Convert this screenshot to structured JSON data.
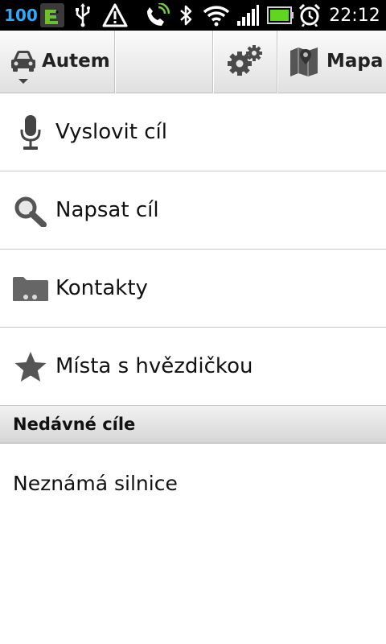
{
  "status_bar": {
    "battery_level": "100",
    "time": "22:12",
    "icons": [
      "app-icon",
      "usb-icon",
      "warning-icon",
      "phone-icon",
      "bluetooth-icon",
      "wifi-icon",
      "signal-icon",
      "battery-icon",
      "alarm-icon"
    ]
  },
  "action_bar": {
    "mode_label": "Autem",
    "map_label": "Mapa",
    "icons": [
      "car-icon",
      "gears-icon",
      "map-icon"
    ]
  },
  "menu": {
    "items": [
      {
        "label": "Vyslovit cíl",
        "icon": "microphone-icon"
      },
      {
        "label": "Napsat cíl",
        "icon": "search-icon"
      },
      {
        "label": "Kontakty",
        "icon": "contacts-folder-icon"
      },
      {
        "label": "Místa s hvězdičkou",
        "icon": "star-icon"
      }
    ]
  },
  "recent": {
    "header": "Nedávné cíle",
    "items": [
      "Neznámá silnice"
    ]
  },
  "colors": {
    "battery_text": "#2fa8ff",
    "app_icon_green": "#6cc12a",
    "battery_green": "#5fd61f"
  }
}
